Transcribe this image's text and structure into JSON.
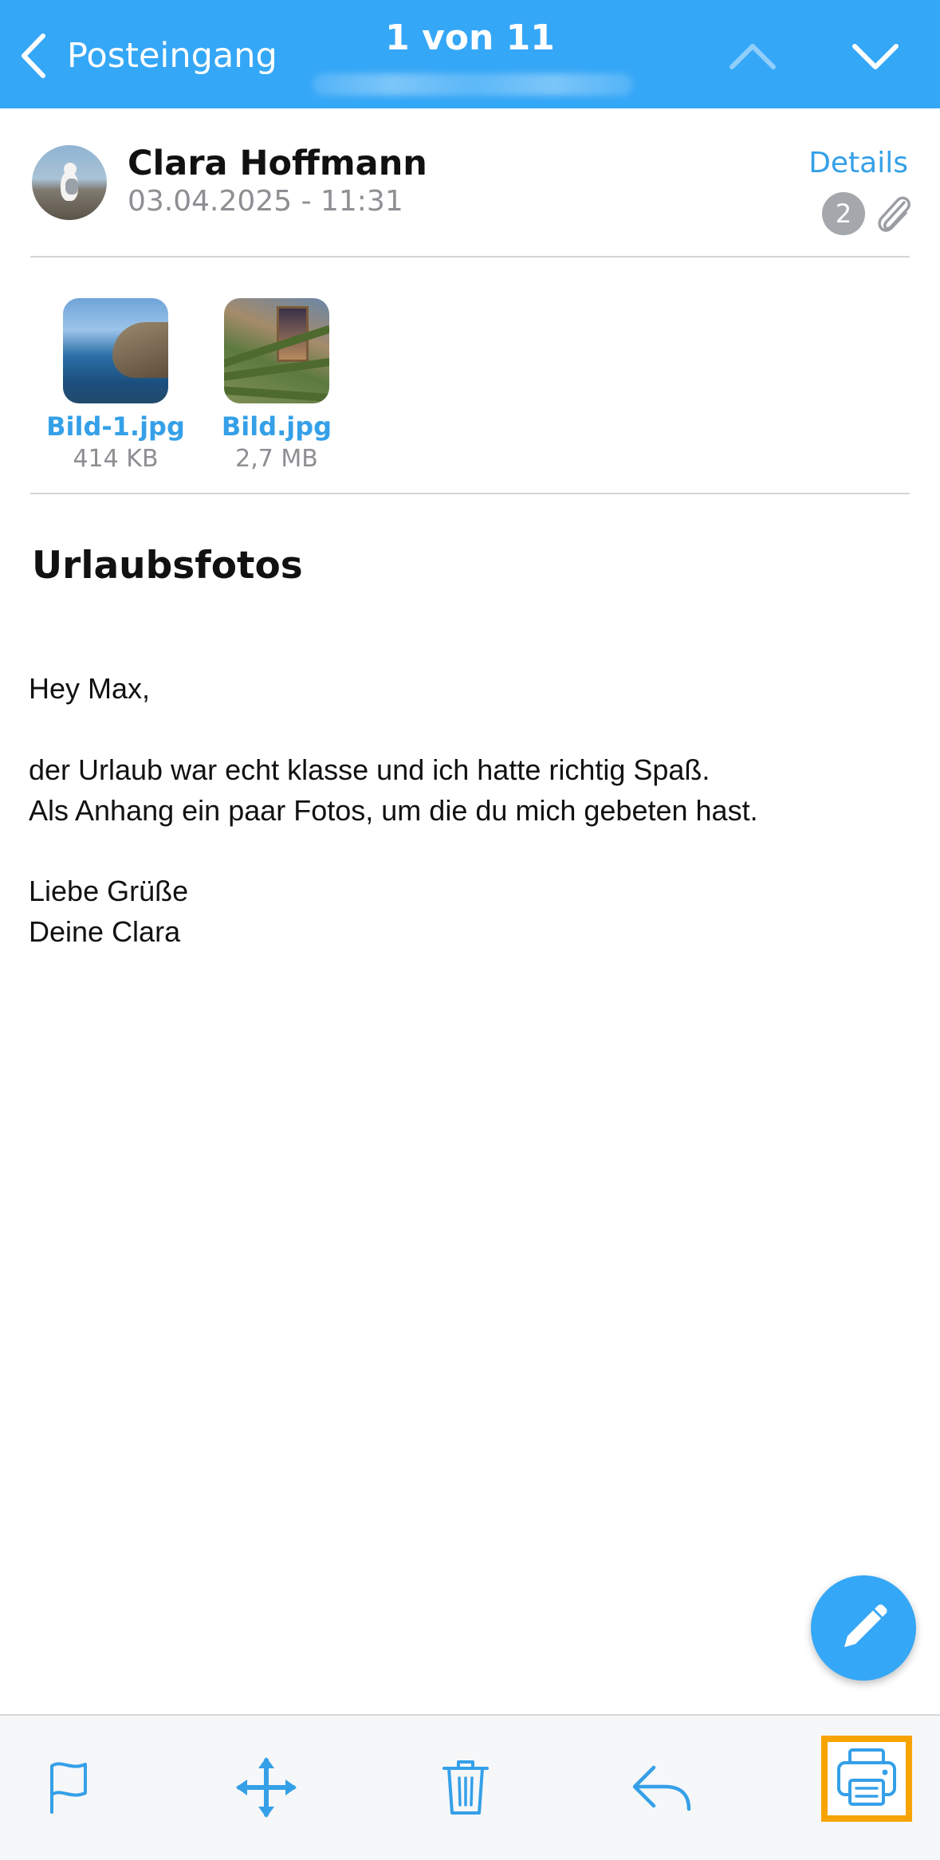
{
  "header": {
    "back_label": "Posteingang",
    "counter": "1 von 11"
  },
  "sender": {
    "name": "Clara Hoffmann",
    "date": "03.04.2025 - 11:31",
    "details_label": "Details",
    "attachment_count": "2"
  },
  "attachments": [
    {
      "name": "Bild-1.jpg",
      "size": "414 KB"
    },
    {
      "name": "Bild.jpg",
      "size": "2,7 MB"
    }
  ],
  "message": {
    "subject": "Urlaubsfotos",
    "greeting": "Hey Max,",
    "line1": "der Urlaub war echt klasse und ich hatte richtig Spaß.",
    "line2": "Als Anhang ein paar Fotos, um die du mich gebeten hast.",
    "closing1": "Liebe Grüße",
    "closing2": "Deine Clara"
  },
  "toolbar": {
    "icons": [
      "flag-icon",
      "move-icon",
      "trash-icon",
      "reply-icon",
      "print-icon"
    ],
    "highlighted": "print-icon"
  },
  "colors": {
    "accent": "#35a7f7",
    "link": "#35a0e8",
    "highlight": "#f7a300",
    "secondary_text": "#8e8e93"
  }
}
